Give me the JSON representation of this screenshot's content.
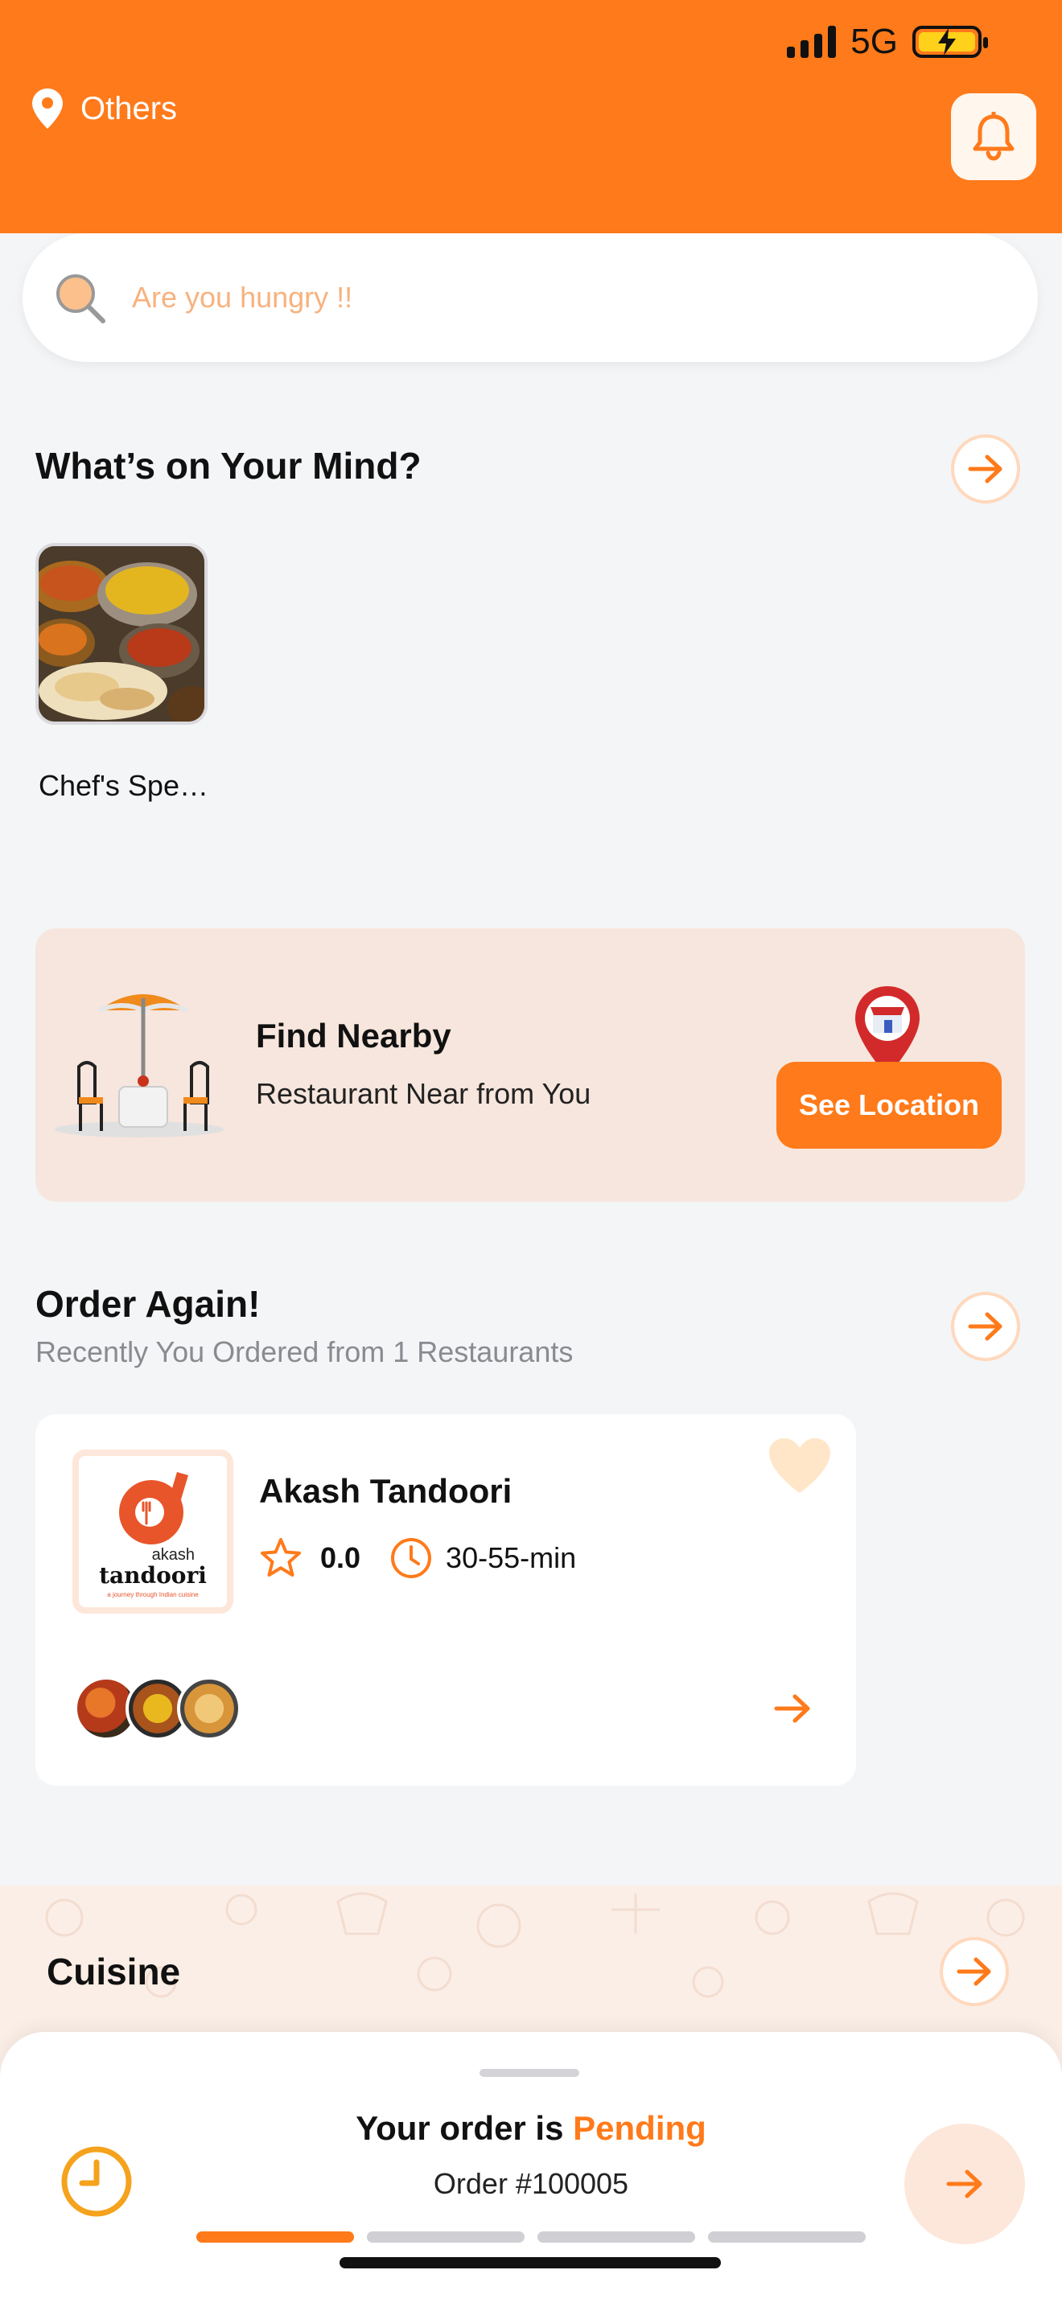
{
  "status_bar": {
    "network": "5G"
  },
  "header": {
    "location": "Others"
  },
  "search": {
    "placeholder": "Are you hungry !!"
  },
  "mind": {
    "title": "What’s on Your Mind?",
    "categories": [
      {
        "label": "Chef's Spe…"
      }
    ]
  },
  "nearby": {
    "title": "Find Nearby",
    "subtitle": "Restaurant Near from You",
    "button": "See Location"
  },
  "order_again": {
    "title": "Order Again!",
    "subtitle": "Recently You Ordered from 1 Restaurants",
    "restaurant": {
      "name": "Akash Tandoori",
      "rating": "0.0",
      "time": "30-55-min",
      "logo_text_top": "akash",
      "logo_text_main": "tandoori",
      "logo_text_tag": "a journey through Indian cuisine"
    }
  },
  "cuisine": {
    "title": "Cuisine"
  },
  "order_status": {
    "prefix": "Your order is ",
    "status": "Pending",
    "order_number": "Order #100005",
    "steps_total": 4,
    "steps_done": 1
  },
  "colors": {
    "accent": "#ff7a1a",
    "accent_light": "#fde7da",
    "background": "#f4f5f7"
  },
  "icons": [
    "location-pin-icon",
    "bell-icon",
    "search-icon",
    "arrow-right-icon",
    "heart-icon",
    "star-icon",
    "clock-icon",
    "umbrella-table-icon",
    "store-pin-icon"
  ]
}
